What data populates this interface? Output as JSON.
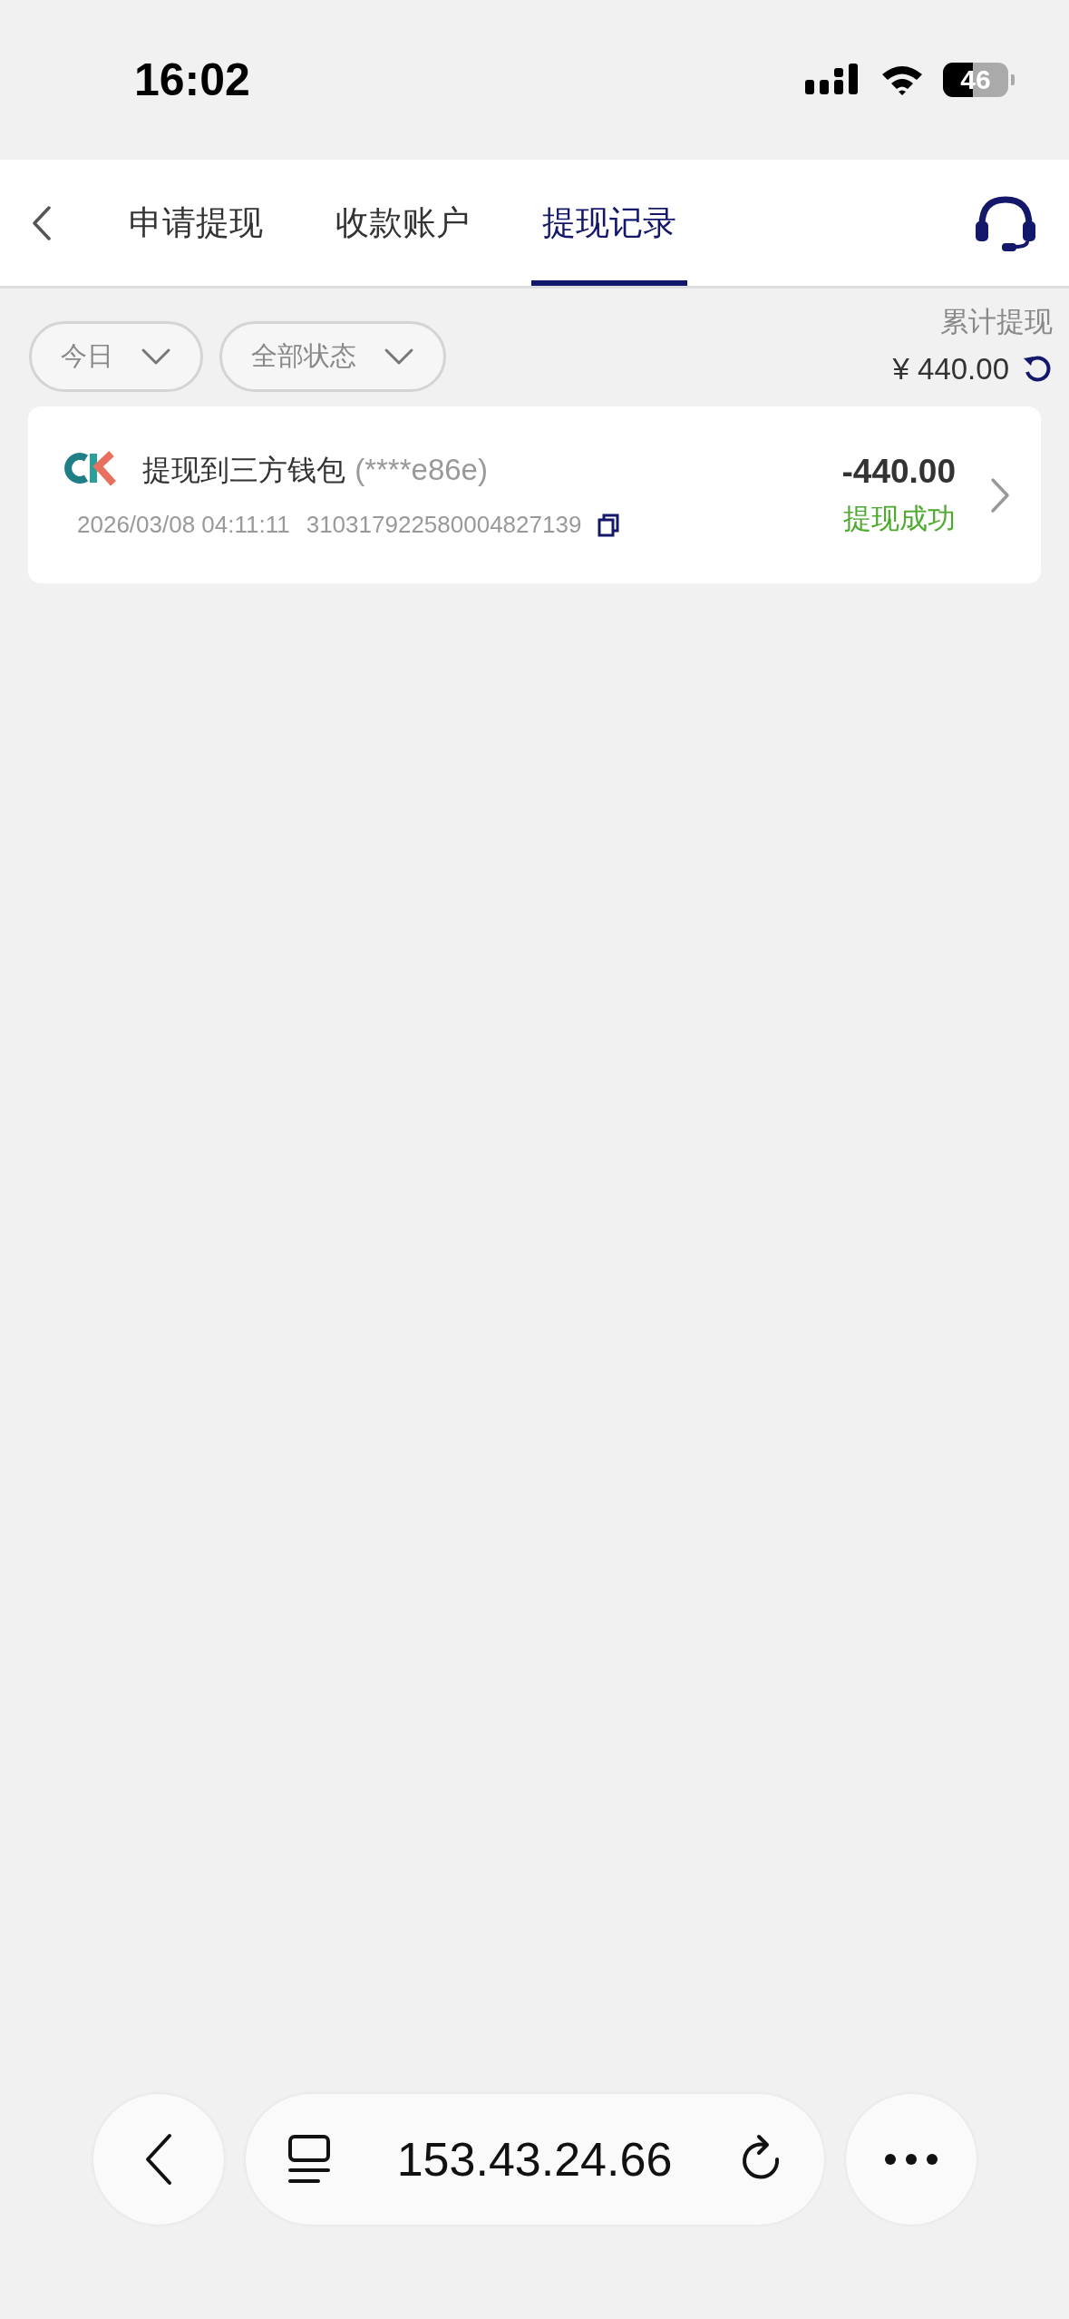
{
  "status_bar": {
    "time": "16:02",
    "battery": "46"
  },
  "tabs": [
    {
      "label": "申请提现",
      "selected": false
    },
    {
      "label": "收款账户",
      "selected": false
    },
    {
      "label": "提现记录",
      "selected": true
    }
  ],
  "filters": [
    {
      "label": "今日"
    },
    {
      "label": "全部状态"
    }
  ],
  "summary": {
    "label": "累计提现",
    "amount": "¥ 440.00"
  },
  "records": [
    {
      "title": "提现到三方钱包",
      "account": "(****e86e)",
      "time": "2026/03/08 04:11:11",
      "order_no": "310317922580004827139",
      "amount": "-440.00",
      "status": "提现成功",
      "color": "#4caa2e"
    }
  ],
  "browser_bar": {
    "url": "153.43.24.66"
  }
}
